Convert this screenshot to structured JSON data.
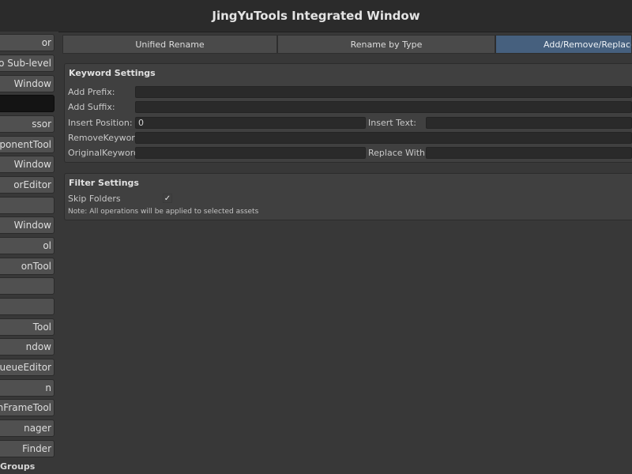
{
  "window": {
    "title": "JingYuTools Integrated Window"
  },
  "sidebar": {
    "items": [
      {
        "label": "or"
      },
      {
        "label": "o Sub-level"
      },
      {
        "label": "Window"
      },
      {
        "label": ""
      },
      {
        "label": "ssor"
      },
      {
        "label": "mponentTool"
      },
      {
        "label": "Window"
      },
      {
        "label": "orEditor"
      },
      {
        "label": ""
      },
      {
        "label": "Window"
      },
      {
        "label": "ol"
      },
      {
        "label": "onTool"
      },
      {
        "label": ""
      },
      {
        "label": ""
      },
      {
        "label": "Tool"
      },
      {
        "label": "ndow"
      },
      {
        "label": "ueueEditor"
      },
      {
        "label": "n"
      },
      {
        "label": "onFrameTool"
      },
      {
        "label": "nager"
      },
      {
        "label": "Finder"
      }
    ],
    "selected_index": 3,
    "group_label": "Groups"
  },
  "tabs": [
    {
      "label": "Unified Rename",
      "active": false
    },
    {
      "label": "Rename by Type",
      "active": false
    },
    {
      "label": "Add/Remove/Replace K",
      "active": true
    }
  ],
  "keyword_settings": {
    "title": "Keyword Settings",
    "add_prefix_label": "Add Prefix:",
    "add_prefix_value": "",
    "add_suffix_label": "Add Suffix:",
    "add_suffix_value": "",
    "insert_position_label": "Insert Position:",
    "insert_position_value": "0",
    "insert_text_label": "Insert Text:",
    "insert_text_value": "",
    "remove_keyword_label": "RemoveKeyword:",
    "remove_keyword_value": "",
    "original_keyword_label": "OriginalKeyword:",
    "original_keyword_value": "",
    "replace_with_label": "Replace With:",
    "replace_with_value": ""
  },
  "filter_settings": {
    "title": "Filter Settings",
    "skip_folders_label": "Skip Folders",
    "skip_folders_checked": true,
    "checkmark": "✓",
    "note": "Note: All operations will be applied to selected assets"
  }
}
